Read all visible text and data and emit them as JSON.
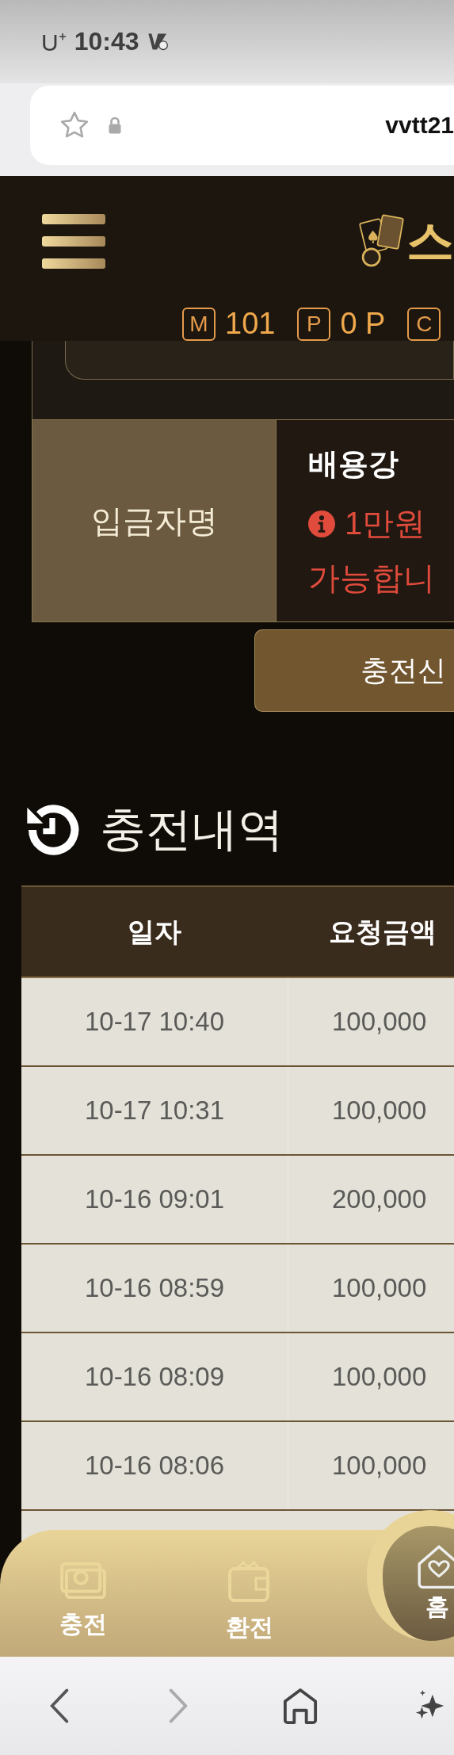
{
  "status_bar": {
    "carrier": "U⁺",
    "time": "10:43"
  },
  "browser": {
    "url": "vvtt21"
  },
  "header": {
    "logo_text": "스",
    "balances": [
      {
        "symbol": "M",
        "value": "101"
      },
      {
        "symbol": "P",
        "value": "0 P"
      },
      {
        "symbol": "C"
      }
    ]
  },
  "form": {
    "label": "입금자명",
    "value": "배용강",
    "warning_lines": [
      "1만원",
      "가능합니"
    ],
    "submit": "충전신"
  },
  "history": {
    "title": "충전내역",
    "columns": [
      "일자",
      "요청금액"
    ],
    "rows": [
      [
        "10-17 10:40",
        "100,000"
      ],
      [
        "10-17 10:31",
        "100,000"
      ],
      [
        "10-16 09:01",
        "200,000"
      ],
      [
        "10-16 08:59",
        "100,000"
      ],
      [
        "10-16 08:09",
        "100,000"
      ],
      [
        "10-16 08:06",
        "100,000"
      ]
    ]
  },
  "bottom_nav": [
    {
      "kind": "money",
      "label": "충전"
    },
    {
      "kind": "wallet",
      "label": "환전"
    },
    {
      "kind": "home",
      "label": "홈"
    }
  ]
}
